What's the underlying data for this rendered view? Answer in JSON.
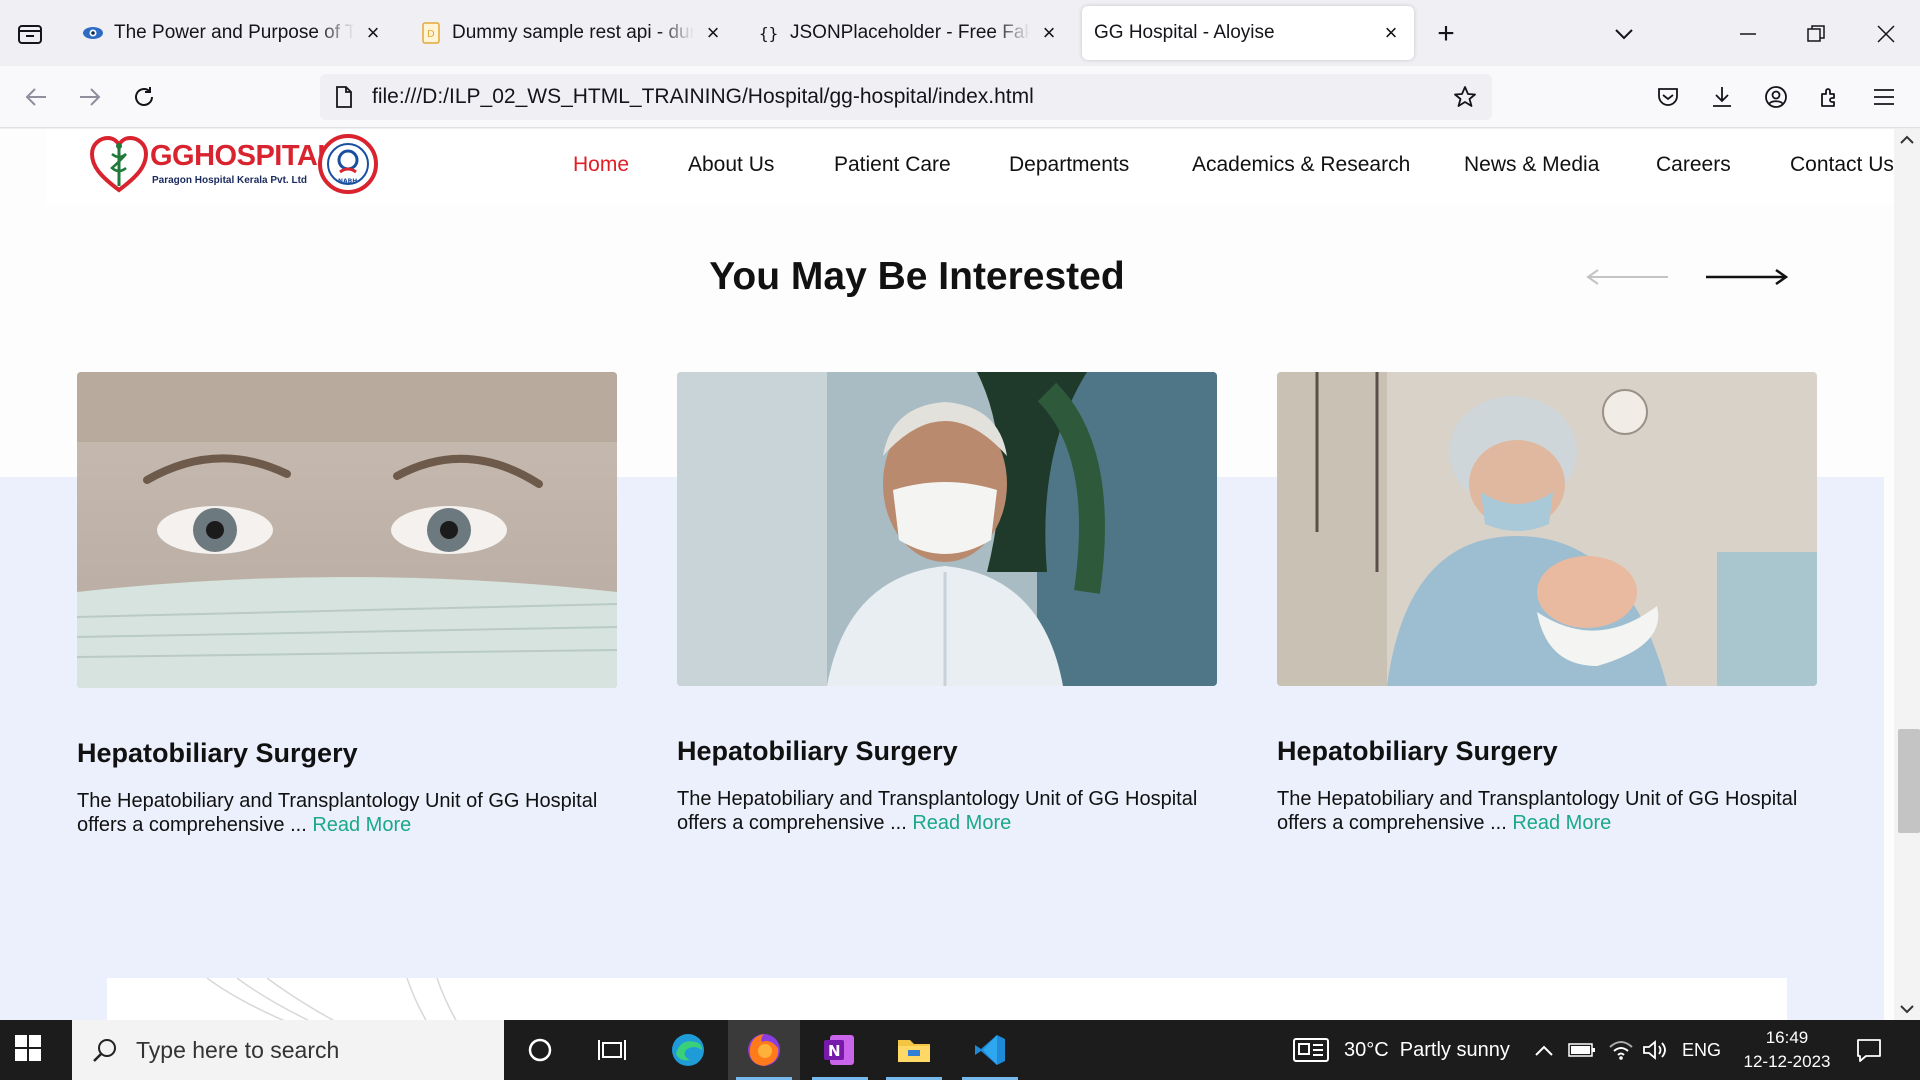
{
  "browser": {
    "tabs": [
      {
        "title": "The Power and Purpose of Team",
        "active": false
      },
      {
        "title": "Dummy sample rest api - dummy",
        "active": false
      },
      {
        "title": "JSONPlaceholder - Free Fake REST API",
        "active": false
      },
      {
        "title": "GG Hospital - Aloyise",
        "active": true
      }
    ],
    "url": "file:///D:/ILP_02_WS_HTML_TRAINING/Hospital/gg-hospital/index.html"
  },
  "site": {
    "logo": {
      "wordmark": "GGHOSPITAL",
      "tagline": "Paragon Hospital Kerala Pvt. Ltd",
      "badge": "NABH"
    },
    "nav": [
      {
        "label": "Home",
        "active": true
      },
      {
        "label": "About Us"
      },
      {
        "label": "Patient Care"
      },
      {
        "label": "Departments"
      },
      {
        "label": "Academics & Research"
      },
      {
        "label": "News & Media"
      },
      {
        "label": "Careers"
      },
      {
        "label": "Contact Us"
      }
    ],
    "section_title": "You May Be Interested",
    "cards": [
      {
        "title": "Hepatobiliary Surgery",
        "text": "The Hepatobiliary and Transplantology Unit of GG Hospital offers a comprehensive ... ",
        "link": "Read More",
        "image": "woman-face-mask-photo"
      },
      {
        "title": "Hepatobiliary Surgery",
        "text": "The Hepatobiliary and Transplantology Unit of GG Hospital offers a comprehensive ... ",
        "link": "Read More",
        "image": "man-face-mask-photo"
      },
      {
        "title": "Hepatobiliary Surgery",
        "text": "The Hepatobiliary and Transplantology Unit of GG Hospital offers a comprehensive ... ",
        "link": "Read More",
        "image": "surgeon-newborn-photo"
      }
    ]
  },
  "taskbar": {
    "search_placeholder": "Type here to search",
    "weather": "30°C  Partly sunny",
    "language": "ENG",
    "time": "16:49",
    "date": "12-12-2023"
  },
  "colors": {
    "accent_red": "#e01e26",
    "link_green": "#1aa88a",
    "section_bg": "#ebf0fc"
  }
}
